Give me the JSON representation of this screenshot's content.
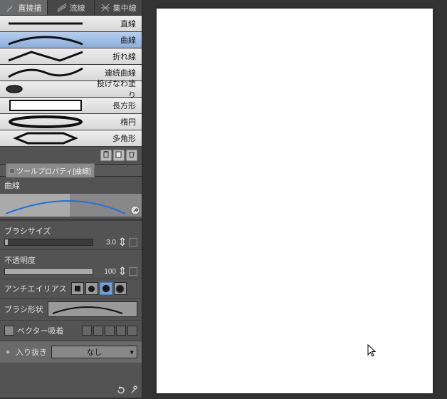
{
  "mode_tabs": [
    {
      "label": "直接描"
    },
    {
      "label": "流線"
    },
    {
      "label": "集中線"
    }
  ],
  "tools": [
    {
      "label": "直線"
    },
    {
      "label": "曲線"
    },
    {
      "label": "折れ線"
    },
    {
      "label": "連続曲線"
    },
    {
      "label": "投げなわ塗り"
    },
    {
      "label": "長方形"
    },
    {
      "label": "楕円"
    },
    {
      "label": "多角形"
    }
  ],
  "prop_tab_label": "ツールプロパティ[曲線]",
  "curve_title": "曲線",
  "brush_size": {
    "label": "ブラシサイズ",
    "value": "3.0"
  },
  "opacity": {
    "label": "不透明度",
    "value": "100"
  },
  "antialias_label": "アンチエイリアス",
  "brush_shape_label": "ブラシ形状",
  "vector_snap_label": "ベクター吸着",
  "in_out": {
    "label": "入り抜き",
    "value": "なし"
  },
  "colors": {
    "curve_blue": "#1f6fe0",
    "selected_bg": "#8caed8"
  }
}
